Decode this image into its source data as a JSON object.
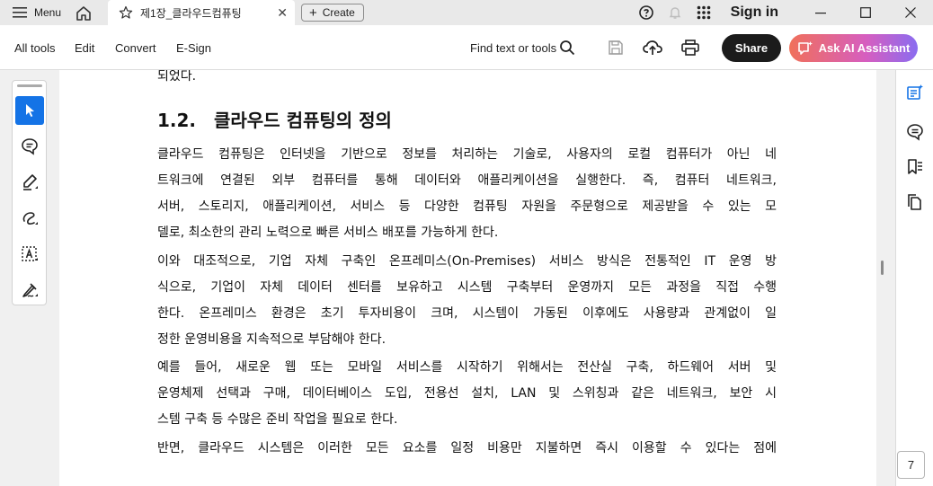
{
  "titlebar": {
    "menu_label": "Menu",
    "tab_title": "제1장_클라우드컴퓨팅",
    "tab_close": "✕",
    "create_label": "Create",
    "sign_in": "Sign in"
  },
  "toolbar": {
    "items": [
      "All tools",
      "Edit",
      "Convert",
      "E-Sign"
    ],
    "find_label": "Find text or tools",
    "share_label": "Share",
    "ask_ai_label": "Ask AI Assistant"
  },
  "document": {
    "top_line": "되었다.",
    "heading_number": "1.2.",
    "heading_text": "클라우드 컴퓨팅의 정의",
    "paragraphs": [
      [
        "클라우드 컴퓨팅은 인터넷을 기반으로 정보를 처리하는 기술로, 사용자의 로컬 컴퓨터가 아닌 네",
        "트워크에 연결된 외부 컴퓨터를 통해 데이터와 애플리케이션을 실행한다. 즉, 컴퓨터 네트워크,",
        "서버, 스토리지, 애플리케이션, 서비스 등 다양한 컴퓨팅 자원을 주문형으로 제공받을 수 있는 모",
        "델로, 최소한의 관리 노력으로 빠른 서비스 배포를 가능하게 한다."
      ],
      [
        "이와 대조적으로, 기업 자체 구축인 온프레미스(On-Premises) 서비스 방식은 전통적인 IT 운영 방",
        "식으로, 기업이 자체 데이터 센터를 보유하고 시스템 구축부터 운영까지 모든 과정을 직접 수행",
        "한다. 온프레미스 환경은 초기 투자비용이 크며, 시스템이 가동된 이후에도 사용량과 관계없이 일",
        "정한 운영비용을 지속적으로 부담해야 한다."
      ],
      [
        "예를 들어, 새로운 웹 또는 모바일 서비스를 시작하기 위해서는 전산실 구축, 하드웨어 서버 및",
        "운영체제 선택과 구매, 데이터베이스 도입, 전용선 설치, LAN 및 스위칭과 같은 네트워크, 보안 시",
        "스템 구축 등 수많은 준비 작업을 필요로 한다."
      ],
      [
        "반면, 클라우드 시스템은 이러한 모든 요소를 일정 비용만 지불하면 즉시 이용할 수 있다는 점에"
      ]
    ]
  },
  "page_indicator": "7",
  "colors": {
    "accent_blue": "#1473e6",
    "share_bg": "#1b1b1b",
    "ai_gradient_start": "#f0705a",
    "ai_gradient_end": "#8a6cf0"
  },
  "icons": {
    "left_tools": [
      "select-cursor-icon",
      "add-comment-icon",
      "highlight-pen-icon",
      "draw-freehand-icon",
      "text-box-icon",
      "sign-pen-icon"
    ],
    "right_tools": [
      "ai-notes-icon",
      "comments-panel-icon",
      "bookmarks-icon",
      "page-thumbnails-icon"
    ]
  }
}
